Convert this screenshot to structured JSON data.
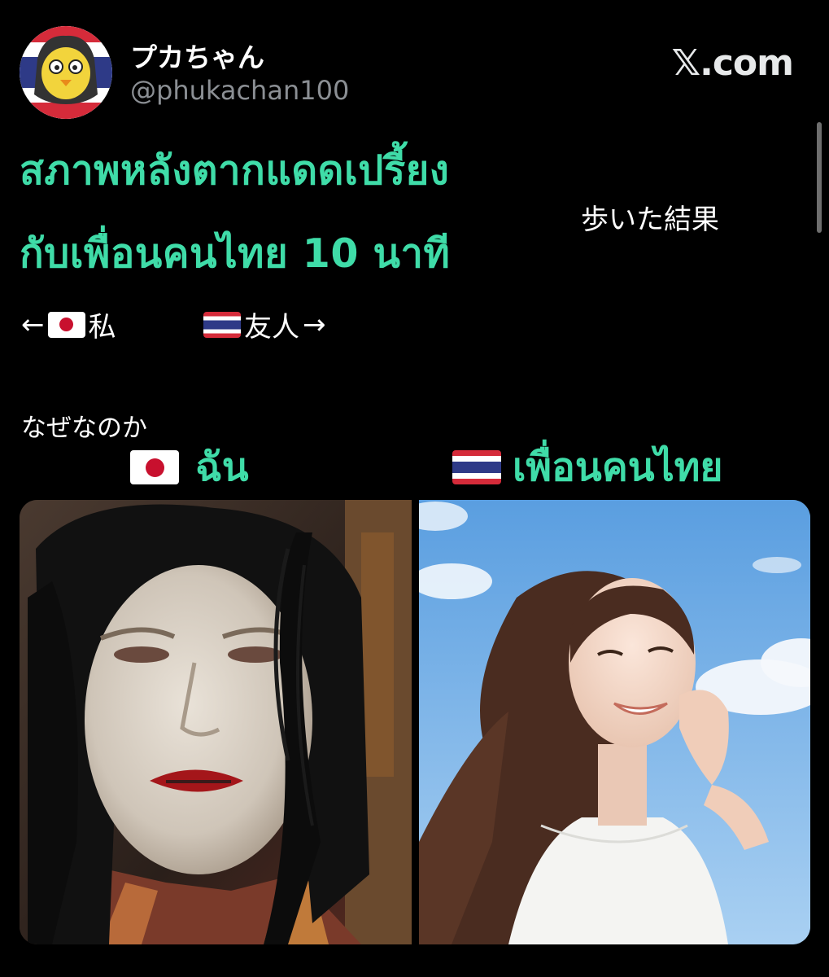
{
  "tweet": {
    "display_name": "プカちゃん",
    "handle": "@phukachan100",
    "site": "𝕏.com"
  },
  "overlay": {
    "headline_line1": "สภาพหลังตากแดดเปรี้ยง",
    "headline_line2": "กับเพื่อนคนไทย 10 นาที",
    "label_me": "ฉัน",
    "label_friend": "เพื่อนคนไทย"
  },
  "tweet_text": {
    "walk_result": "歩いた結果",
    "me_prefix": "←",
    "me": "私",
    "friend": "友人",
    "friend_suffix": "→",
    "why": "なぜなのか"
  },
  "icons": {
    "avatar": "avatar-icon",
    "jp_flag": "japan-flag-icon",
    "th_flag": "thailand-flag-icon"
  },
  "colors": {
    "headline": "#3fdca8",
    "handle": "#8b8f94",
    "background": "#000000"
  }
}
